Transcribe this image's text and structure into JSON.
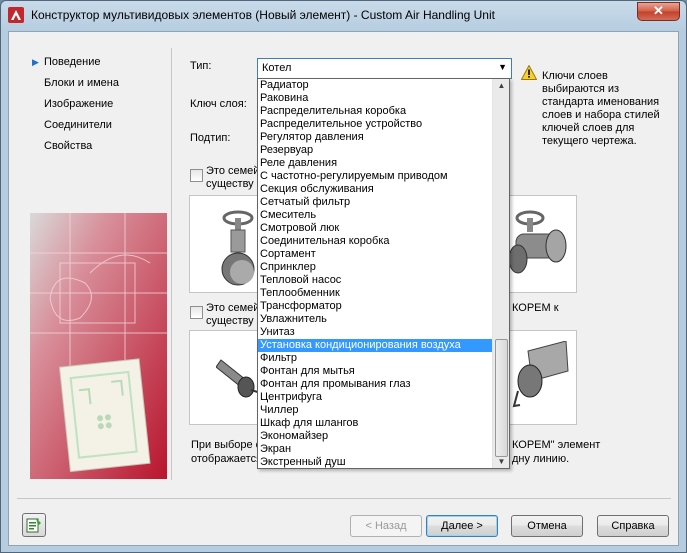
{
  "window": {
    "title": "Конструктор мультивидовых элементов (Новый элемент) - Custom Air Handling Unit",
    "close_glyph": "✕"
  },
  "nav": {
    "items": [
      {
        "label": "Поведение",
        "active": true
      },
      {
        "label": "Блоки и имена",
        "active": false
      },
      {
        "label": "Изображение",
        "active": false
      },
      {
        "label": "Соединители",
        "active": false
      },
      {
        "label": "Свойства",
        "active": false
      }
    ]
  },
  "form": {
    "type_label": "Тип:",
    "type_value": "Котел",
    "layer_key_label": "Ключ слоя:",
    "subtype_label": "Подтип:",
    "warning_text": "Ключи слоев выбираются из стандарта именования слоев и набора стилей ключей слоев для текущего чертежа."
  },
  "options": {
    "option1_label_l1": "Это семей",
    "option1_label_l2": "существу",
    "option2_label_l1": "Это семей",
    "option2_label_l2": "существу",
    "option2_right_text": "КОРЕМ к",
    "bottom_text_l1": "При выборе с",
    "bottom_text_l2": "отображается",
    "bottom_text_r1": "КОРЕМ\" элемент",
    "bottom_text_r2": "дну линию."
  },
  "dropdown": {
    "items": [
      "Радиатор",
      "Раковина",
      "Распределительная коробка",
      "Распределительное устройство",
      "Регулятор давления",
      "Резервуар",
      "Реле давления",
      "С частотно-регулируемым приводом",
      "Секция обслуживания",
      "Сетчатый фильтр",
      "Смеситель",
      "Смотровой люк",
      "Соединительная коробка",
      "Сортамент",
      "Спринклер",
      "Тепловой насос",
      "Теплообменник",
      "Трансформатор",
      "Увлажнитель",
      "Унитаз",
      "Установка кондиционирования воздуха",
      "Фильтр",
      "Фонтан для мытья",
      "Фонтан для промывания глаз",
      "Центрифуга",
      "Чиллер",
      "Шкаф для шлангов",
      "Экономайзер",
      "Экран",
      "Экстренный душ"
    ],
    "selected": "Установка кондиционирования воздуха"
  },
  "buttons": {
    "back": "< Назад",
    "next": "Далее >",
    "cancel": "Отмена",
    "help": "Справка"
  },
  "colors": {
    "selection": "#3399ff",
    "art_red": "#c2283d",
    "warning_yellow": "#f7d030"
  },
  "icons": {
    "app": "autocad-logo-icon",
    "warning": "warning-icon",
    "bottom_left": "style-manager-icon"
  }
}
